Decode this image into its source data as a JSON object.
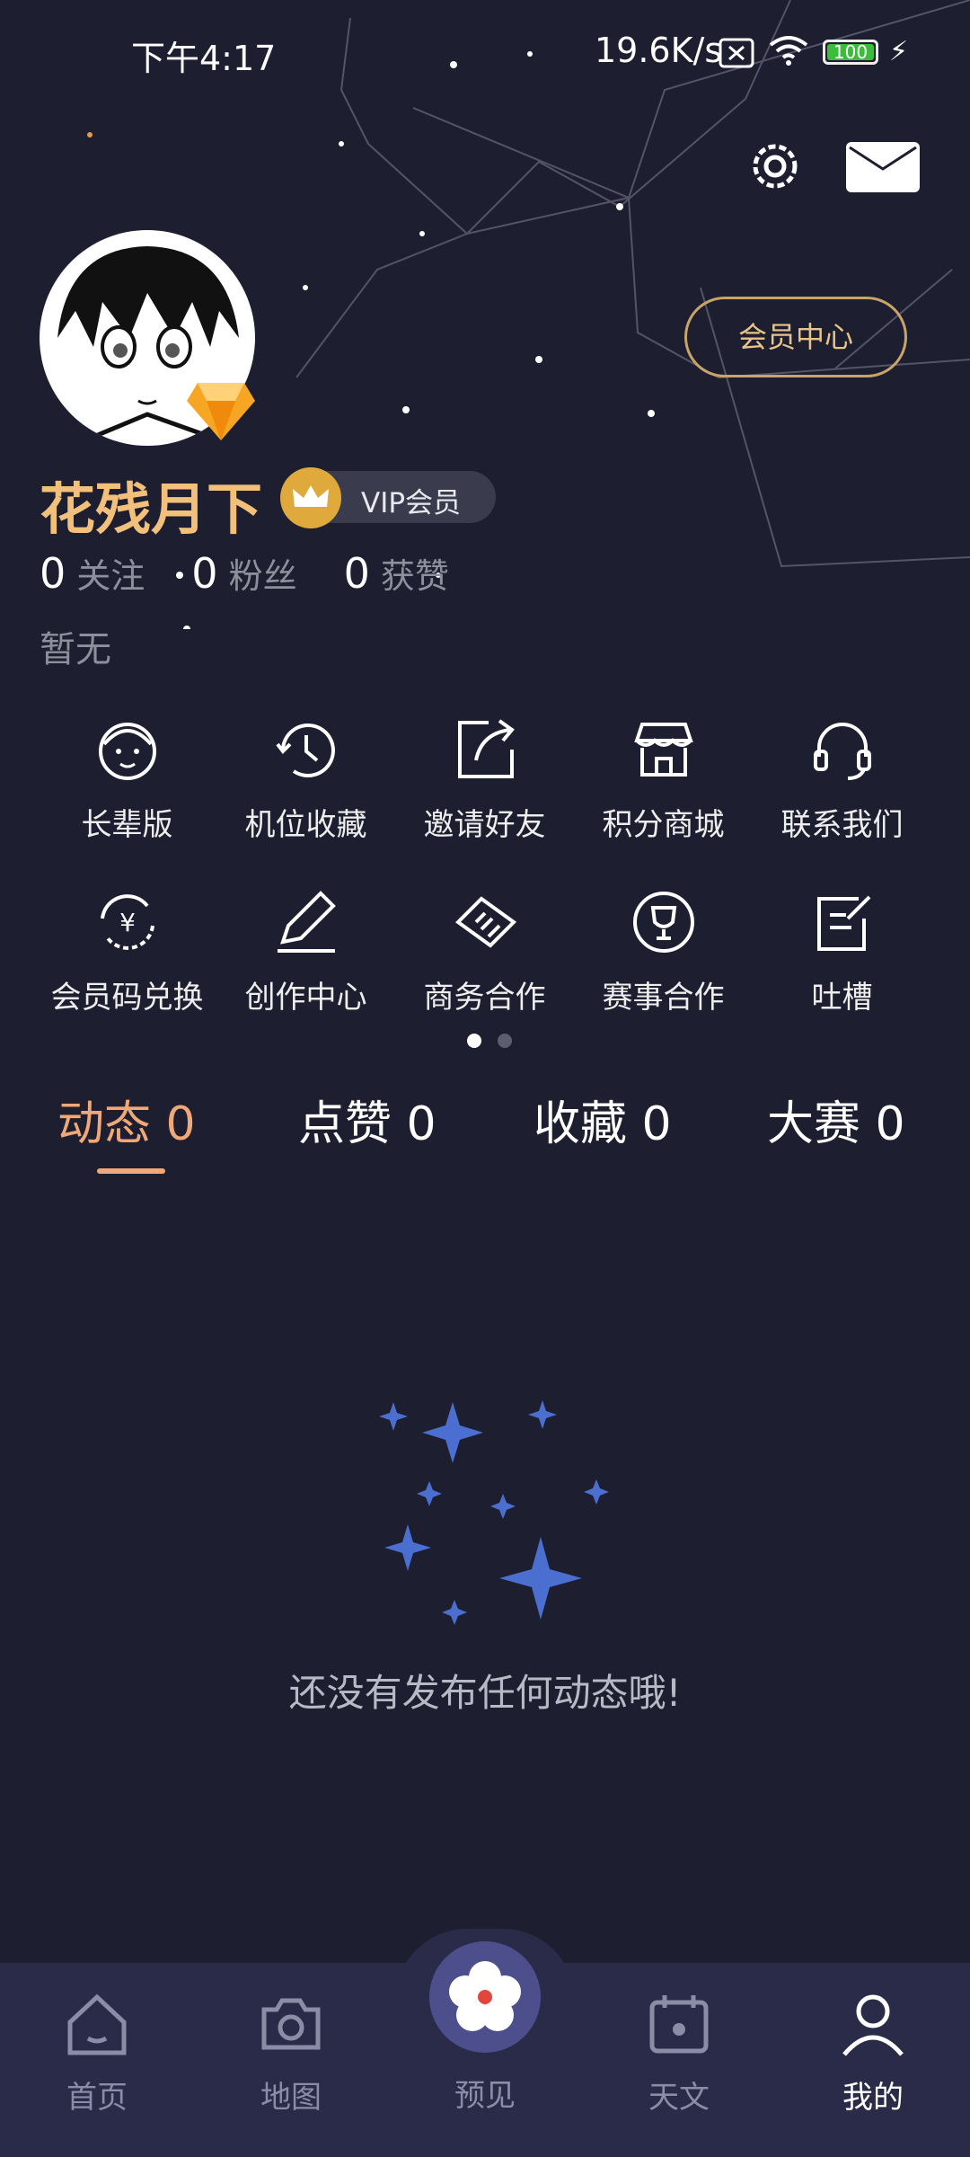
{
  "status_bar": {
    "time": "下午4:17",
    "speed": "19.6K/s",
    "battery": "100"
  },
  "header": {
    "vip_center_label": "会员中心"
  },
  "profile": {
    "username": "花残月下",
    "vip_badge_label": "VIP会员",
    "following_count": "0",
    "following_label": "关注",
    "fans_count": "0",
    "fans_label": "粉丝",
    "likes_count": "0",
    "likes_label": "获赞",
    "bio": "暂无"
  },
  "features": {
    "row1": [
      {
        "label": "长辈版",
        "icon": "elder-face-icon"
      },
      {
        "label": "机位收藏",
        "icon": "clock-history-icon"
      },
      {
        "label": "邀请好友",
        "icon": "share-icon"
      },
      {
        "label": "积分商城",
        "icon": "store-icon"
      },
      {
        "label": "联系我们",
        "icon": "headset-icon"
      }
    ],
    "row2": [
      {
        "label": "会员码兑换",
        "icon": "yuan-exchange-icon"
      },
      {
        "label": "创作中心",
        "icon": "pencil-icon"
      },
      {
        "label": "商务合作",
        "icon": "handshake-icon"
      },
      {
        "label": "赛事合作",
        "icon": "trophy-icon"
      },
      {
        "label": "吐槽",
        "icon": "feedback-icon"
      }
    ]
  },
  "tabs": [
    {
      "label": "动态 0",
      "active": true
    },
    {
      "label": "点赞 0",
      "active": false
    },
    {
      "label": "收藏 0",
      "active": false
    },
    {
      "label": "大赛 0",
      "active": false
    }
  ],
  "empty_state": {
    "message": "还没有发布任何动态哦!"
  },
  "bottom_nav": [
    {
      "label": "首页",
      "icon": "home-icon"
    },
    {
      "label": "地图",
      "icon": "camera-icon"
    },
    {
      "label": "预见",
      "icon": "flower-icon"
    },
    {
      "label": "天文",
      "icon": "calendar-icon"
    },
    {
      "label": "我的",
      "icon": "user-icon",
      "active": true
    }
  ],
  "colors": {
    "background": "#1d1e2f",
    "accent_gold": "#f2c07b",
    "tab_active": "#f0a878",
    "nav_bg": "#2a2b48",
    "sparkle": "#4b6fd0"
  }
}
